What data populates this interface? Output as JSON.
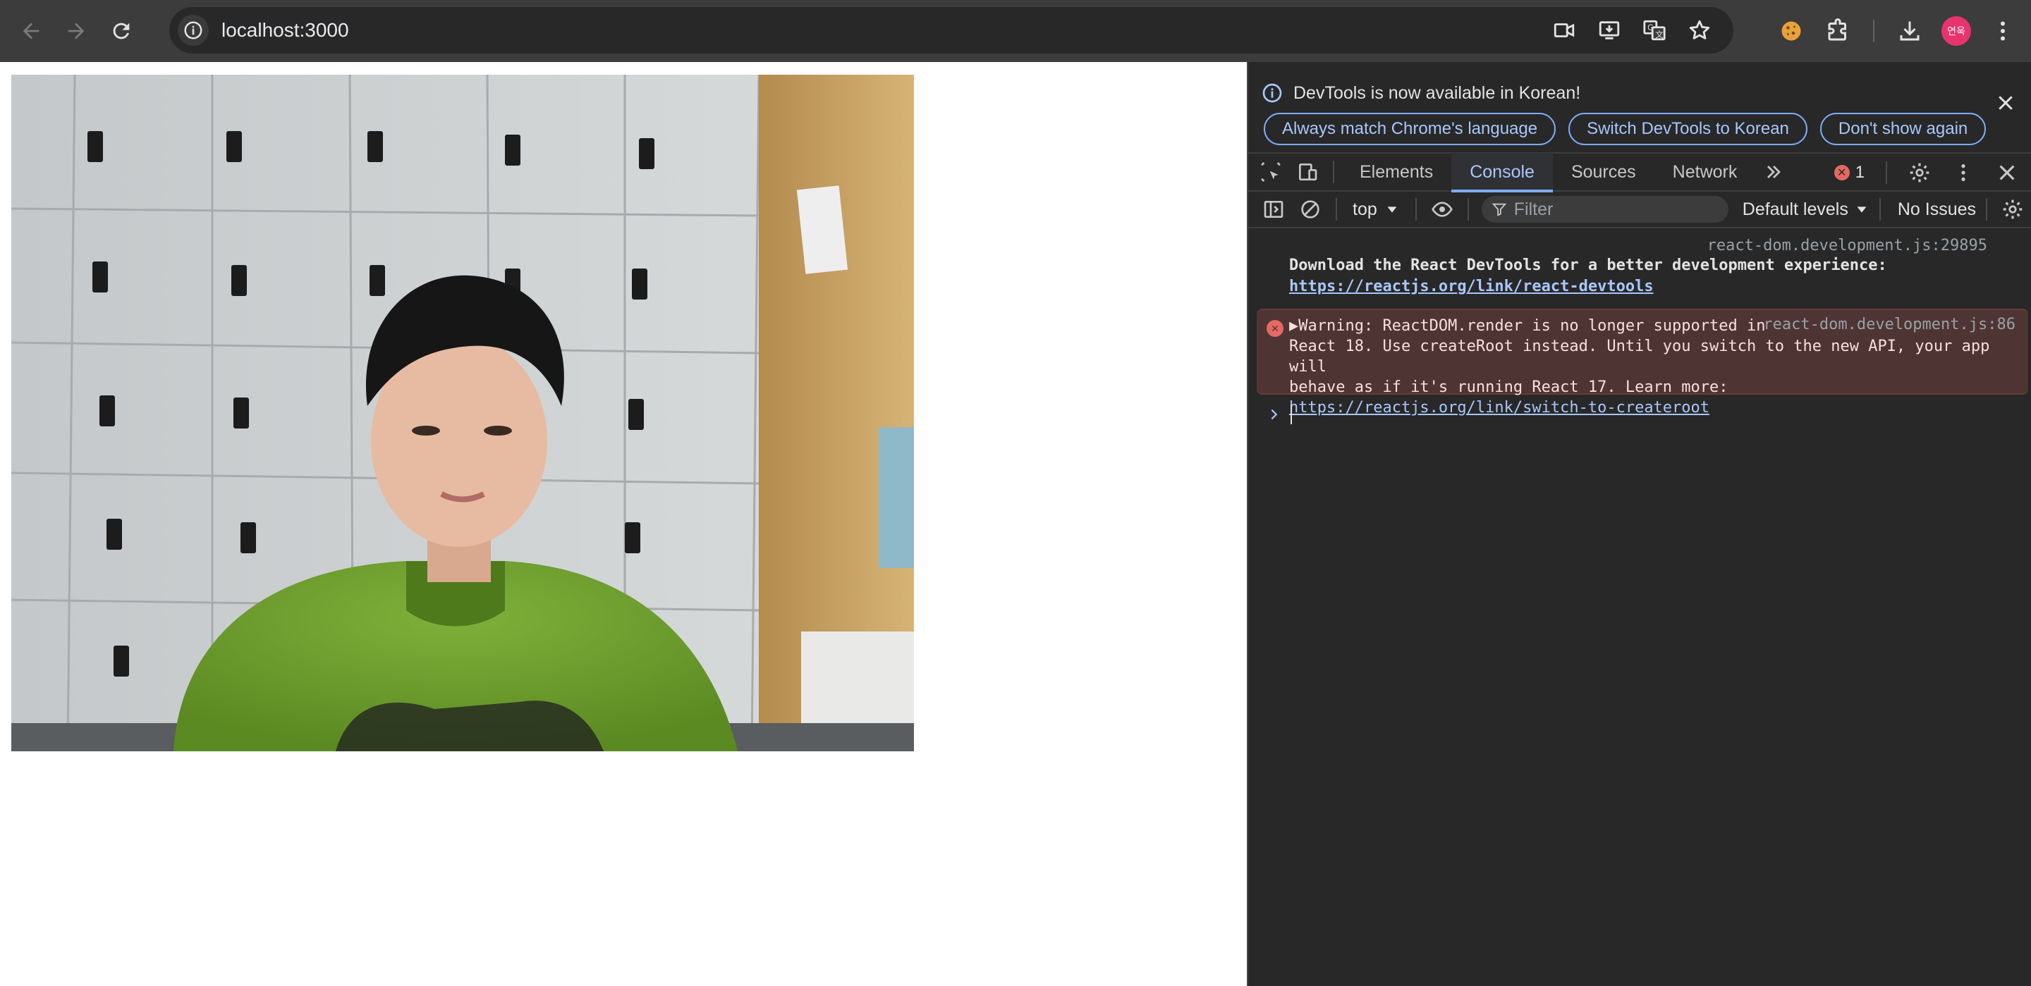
{
  "browser": {
    "url": "localhost:3000",
    "profile_initials": "연욱",
    "nav_icons": [
      "back-icon",
      "forward-icon",
      "reload-icon"
    ],
    "omnibox_icons": [
      "camera-icon",
      "install-icon",
      "translate-icon",
      "bookmark-star-icon"
    ],
    "toolbar_icons": [
      "cookie-extension-icon",
      "extensions-puzzle-icon",
      "downloads-icon",
      "menu-kebab-icon"
    ]
  },
  "devtools": {
    "infobar": {
      "message": "DevTools is now available in Korean!",
      "buttons": [
        "Always match Chrome's language",
        "Switch DevTools to Korean",
        "Don't show again"
      ]
    },
    "tabs": [
      "Elements",
      "Console",
      "Sources",
      "Network"
    ],
    "active_tab": "Console",
    "error_count": "1",
    "console_toolbar": {
      "context": "top",
      "filter_placeholder": "Filter",
      "levels": "Default levels",
      "issues": "No Issues"
    },
    "messages": [
      {
        "source": "react-dom.development.js:29895",
        "line1": "Download the React DevTools for a better development experience:",
        "link": "https://reactjs.org/link/react-devtools"
      },
      {
        "level": "error",
        "source": "react-dom.development.js:86",
        "line1": "Warning: ReactDOM.render is no longer supported in",
        "line2": "React 18. Use createRoot instead. Until you switch to the new API, your app will",
        "line3": "behave as if it's running React 17. Learn more:",
        "link": "https://reactjs.org/link/switch-to-createroot"
      }
    ]
  },
  "colors": {
    "accent": "#7cacf8",
    "error": "#e46962",
    "error_bg": "#4e3534",
    "avatar": "#e8336e"
  }
}
